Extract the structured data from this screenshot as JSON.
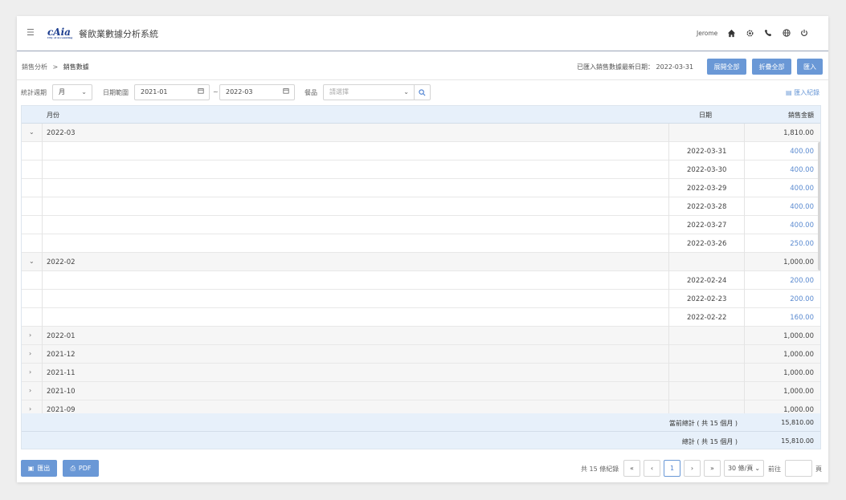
{
  "header": {
    "logo_text": "cAia",
    "logo_subtext": "City of Accounting",
    "app_title": "餐飲業數據分析系統",
    "user_name": "Jerome",
    "icons": [
      "menu-icon",
      "home-icon",
      "gear-icon",
      "phone-icon",
      "globe-icon",
      "power-icon"
    ]
  },
  "breadcrumb": {
    "parent": "銷售分析",
    "separator": ">",
    "current": "銷售數據"
  },
  "toolbar": {
    "import_date_label": "已匯入銷售數據最新日期：",
    "import_date_value": "2022-03-31",
    "expand_all": "展開全部",
    "collapse_all": "折疊全部",
    "import": "匯入"
  },
  "filters": {
    "period_label": "統計週期",
    "period_value": "月",
    "date_range_label": "日期範圍",
    "date_from": "2021-01",
    "date_sep": "~",
    "date_to": "2022-03",
    "meal_label": "餐品",
    "meal_placeholder": "請選擇",
    "import_log": "匯入紀錄"
  },
  "table": {
    "columns": [
      "月份",
      "日期",
      "銷售金額"
    ],
    "rows": [
      {
        "type": "parent",
        "expanded": true,
        "month": "2022-03",
        "date": "",
        "amount": "1,810.00"
      },
      {
        "type": "child",
        "month": "",
        "date": "2022-03-31",
        "amount": "400.00"
      },
      {
        "type": "child",
        "month": "",
        "date": "2022-03-30",
        "amount": "400.00"
      },
      {
        "type": "child",
        "month": "",
        "date": "2022-03-29",
        "amount": "400.00"
      },
      {
        "type": "child",
        "month": "",
        "date": "2022-03-28",
        "amount": "400.00"
      },
      {
        "type": "child",
        "month": "",
        "date": "2022-03-27",
        "amount": "400.00"
      },
      {
        "type": "child",
        "month": "",
        "date": "2022-03-26",
        "amount": "250.00"
      },
      {
        "type": "parent",
        "expanded": true,
        "month": "2022-02",
        "date": "",
        "amount": "1,000.00"
      },
      {
        "type": "child",
        "month": "",
        "date": "2022-02-24",
        "amount": "200.00"
      },
      {
        "type": "child",
        "month": "",
        "date": "2022-02-23",
        "amount": "200.00"
      },
      {
        "type": "child",
        "month": "",
        "date": "2022-02-22",
        "amount": "160.00"
      },
      {
        "type": "parent",
        "expanded": false,
        "month": "2022-01",
        "date": "",
        "amount": "1,000.00"
      },
      {
        "type": "parent",
        "expanded": false,
        "month": "2021-12",
        "date": "",
        "amount": "1,000.00"
      },
      {
        "type": "parent",
        "expanded": false,
        "month": "2021-11",
        "date": "",
        "amount": "1,000.00"
      },
      {
        "type": "parent",
        "expanded": false,
        "month": "2021-10",
        "date": "",
        "amount": "1,000.00"
      },
      {
        "type": "parent",
        "expanded": false,
        "month": "2021-09",
        "date": "",
        "amount": "1,000.00"
      }
    ],
    "current_total_label": "當前總計 ( 共 15 個月 )",
    "current_total_value": "15,810.00",
    "total_label": "總計 ( 共 15 個月 )",
    "total_value": "15,810.00"
  },
  "footer": {
    "export": "匯出",
    "pdf": "PDF",
    "total_records": "共 15 條紀錄",
    "first": "«",
    "prev": "‹",
    "current_page": "1",
    "next": "›",
    "last": "»",
    "page_size": "30 條/頁",
    "goto_label": "前往",
    "goto_suffix": "頁"
  },
  "colors": {
    "accent": "#6a98d6",
    "link": "#5a8ad0",
    "header_bg": "#e7f0fa"
  }
}
